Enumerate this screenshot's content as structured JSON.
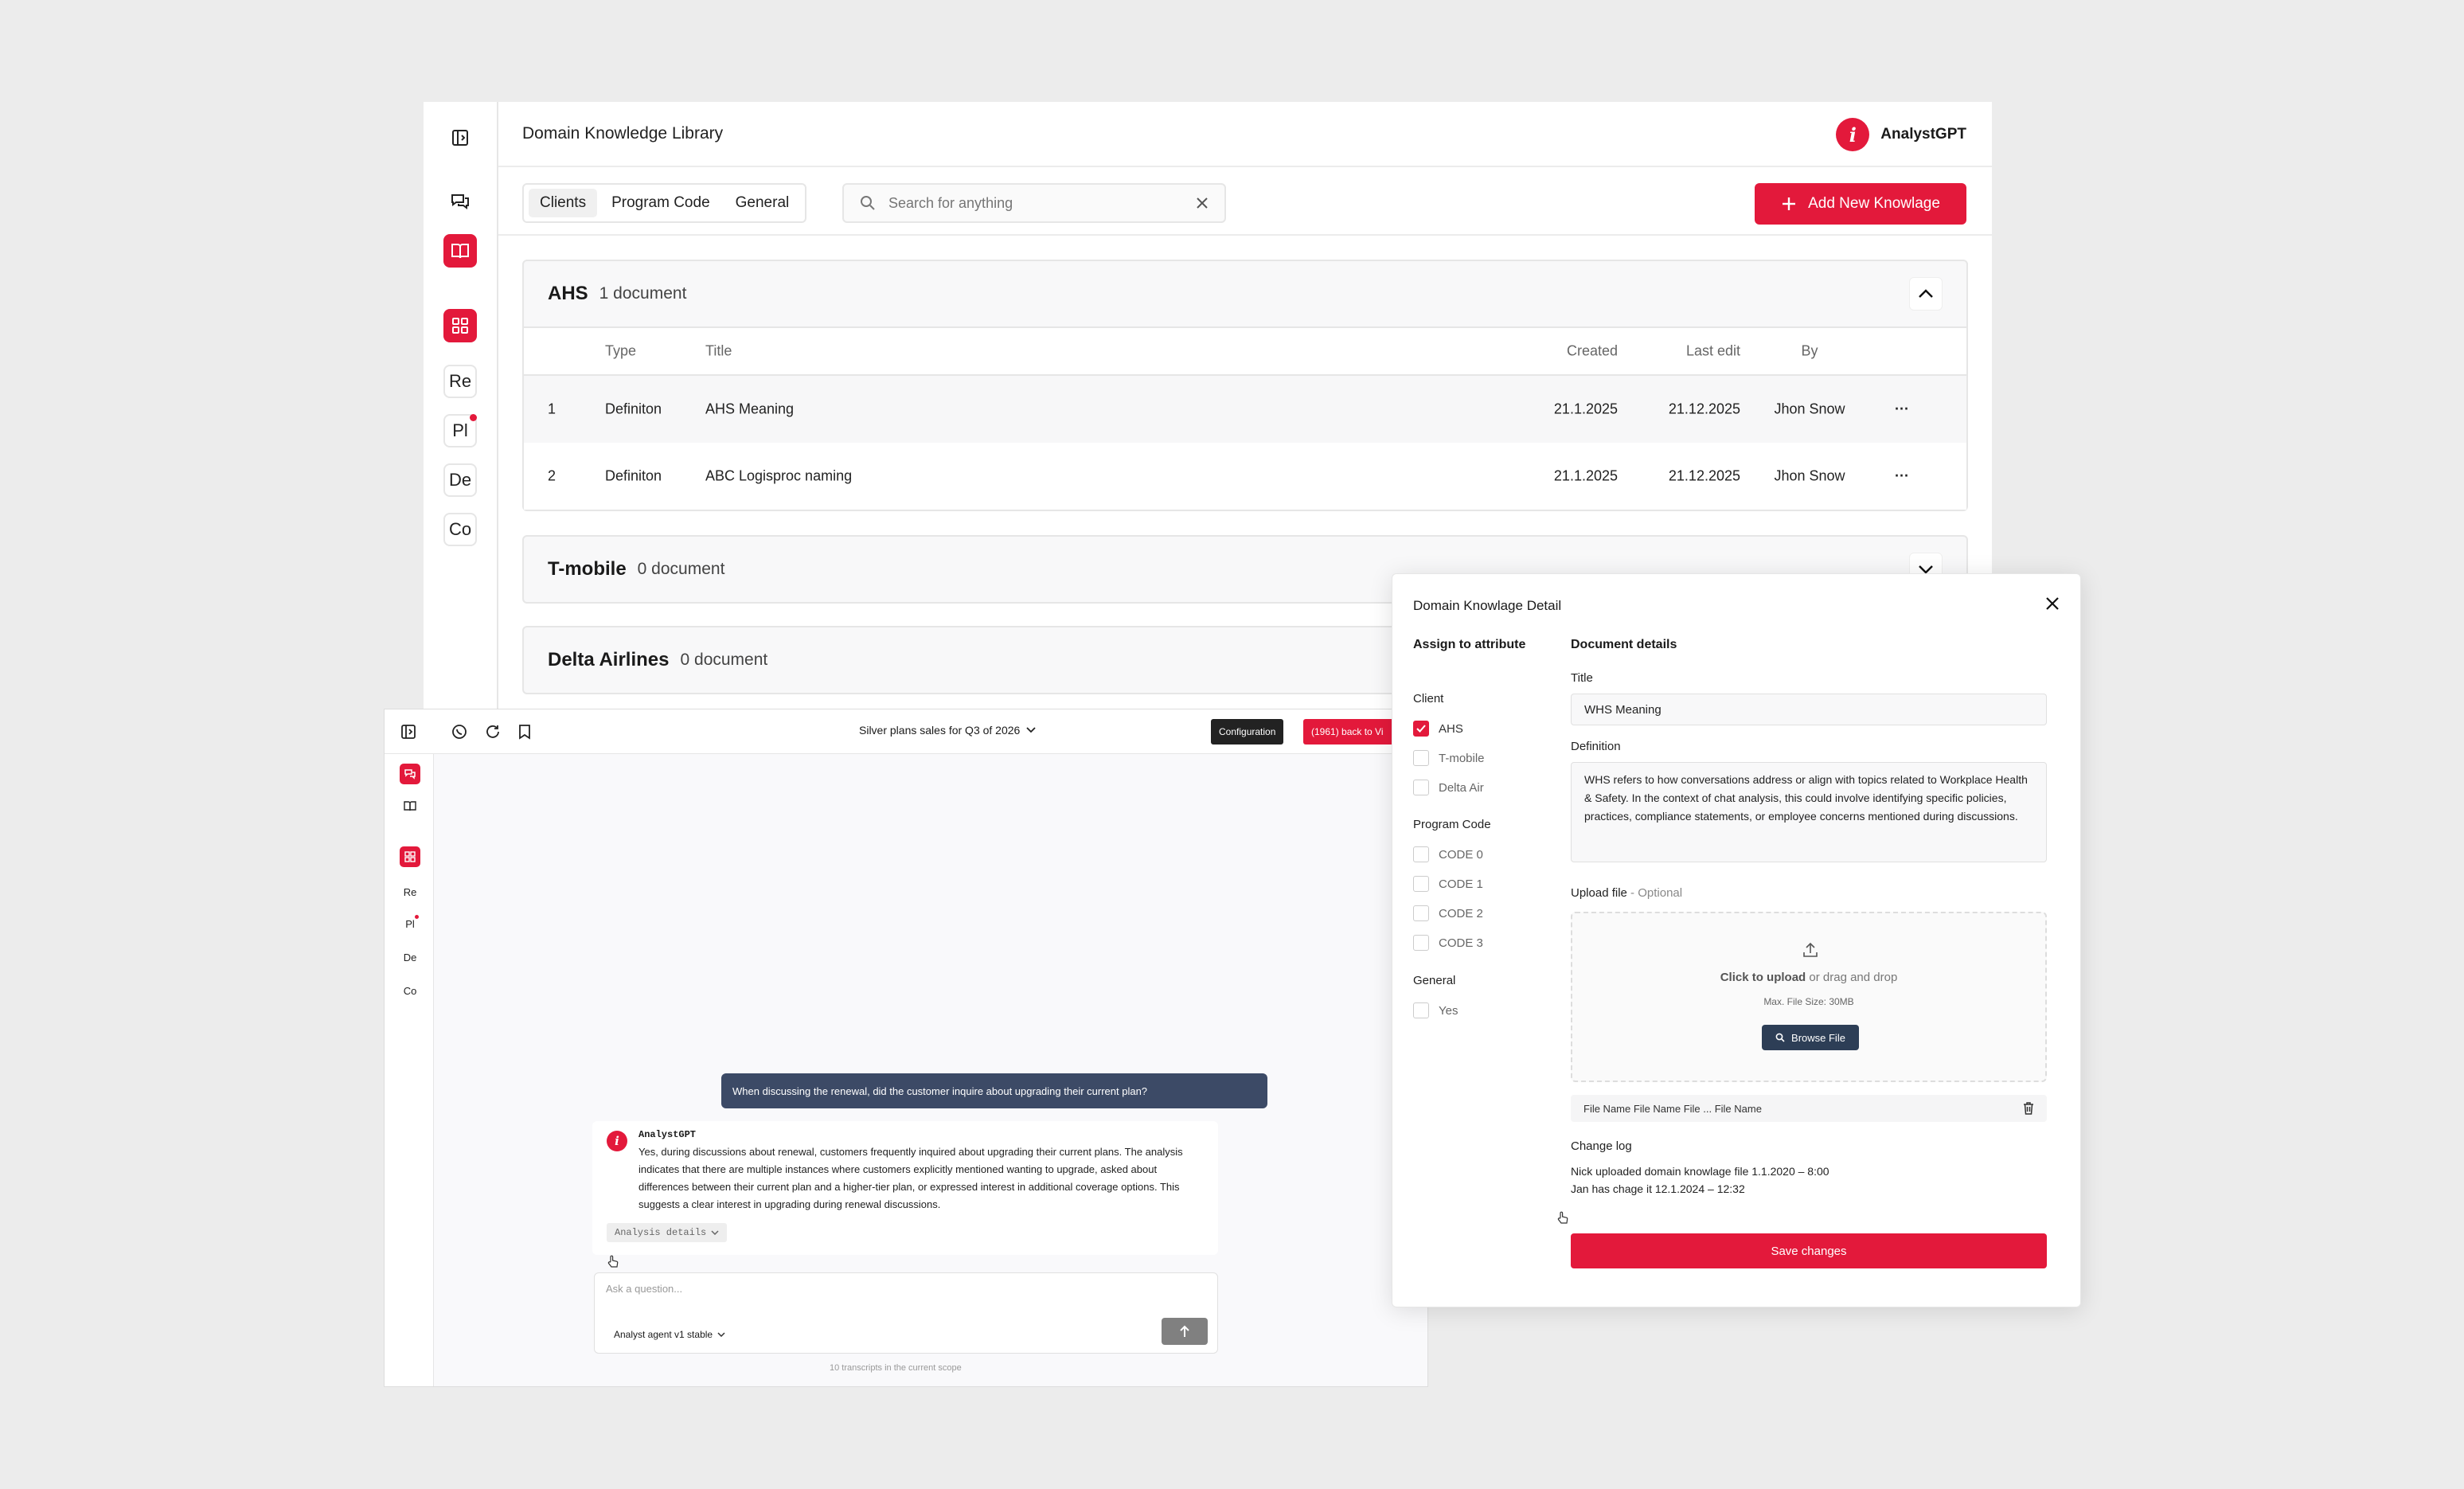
{
  "main": {
    "title": "Domain Knowledge Library",
    "brand": {
      "logo_letter": "i",
      "name": "AnalystGPT",
      "color": "#e3193b"
    },
    "rail_shortcuts": [
      "Re",
      "Pl",
      "De",
      "Co"
    ],
    "tabs": [
      {
        "label": "Clients",
        "active": true
      },
      {
        "label": "Program Code",
        "active": false
      },
      {
        "label": "General",
        "active": false
      }
    ],
    "search": {
      "placeholder": "Search for anything"
    },
    "add_button": "Add New Knowlage",
    "columns": {
      "type": "Type",
      "title": "Title",
      "created": "Created",
      "last_edit": "Last edit",
      "by": "By"
    },
    "groups": [
      {
        "name": "AHS",
        "count": "1 document",
        "expanded": true,
        "rows": [
          {
            "num": "1",
            "type": "Definiton",
            "title": "AHS Meaning",
            "created": "21.1.2025",
            "last_edit": "21.12.2025",
            "by": "Jhon Snow",
            "more": "···"
          },
          {
            "num": "2",
            "type": "Definiton",
            "title": "ABC Logisproc naming",
            "created": "21.1.2025",
            "last_edit": "21.12.2025",
            "by": "Jhon Snow",
            "more": "···"
          }
        ]
      },
      {
        "name": "T-mobile",
        "count": "0 document",
        "expanded": false
      },
      {
        "name": "Delta Airlines",
        "count": "0 document",
        "expanded": false
      }
    ]
  },
  "chat": {
    "rail_shortcuts": [
      "Re",
      "Pl",
      "De",
      "Co"
    ],
    "scope_title": "Silver plans sales for Q3 of 2026",
    "configuration_button": "Configuration",
    "back_button": "(1961) back to Vi",
    "user_message": "When discussing the renewal, did the customer inquire about upgrading their current plan?",
    "bot_name": "AnalystGPT",
    "bot_message": "Yes, during discussions about renewal, customers frequently inquired about upgrading their current plans. The analysis indicates that there are multiple instances where customers explicitly mentioned wanting to upgrade, asked about differences between their current plan and a higher-tier plan, or expressed interest in additional coverage options. This suggests a clear interest in upgrading during renewal discussions.",
    "analysis_details": "Analysis details",
    "composer_placeholder": "Ask a question...",
    "agent": "Analyst agent v1 stable",
    "scope_note": "10 transcripts in the current scope"
  },
  "detail": {
    "title": "Domain Knowlage Detail",
    "assign_heading": "Assign to attribute",
    "client_label": "Client",
    "clients": [
      {
        "label": "AHS",
        "checked": true
      },
      {
        "label": "T-mobile",
        "checked": false
      },
      {
        "label": "Delta Air",
        "checked": false
      }
    ],
    "program_code_label": "Program Code",
    "program_codes": [
      {
        "label": "CODE 0",
        "checked": false
      },
      {
        "label": "CODE 1",
        "checked": false
      },
      {
        "label": "CODE 2",
        "checked": false
      },
      {
        "label": "CODE 3",
        "checked": false
      }
    ],
    "general_label": "General",
    "general_options": [
      {
        "label": "Yes",
        "checked": false
      }
    ],
    "doc_heading": "Document details",
    "title_label": "Title",
    "title_value": "WHS Meaning",
    "definition_label": "Definition",
    "definition_value": "WHS refers to how conversations address or align with topics related to Workplace Health & Safety. In the context of chat analysis, this could involve identifying specific policies, practices, compliance statements, or employee concerns mentioned during discussions.",
    "upload_label": "Upload file",
    "upload_optional": " - Optional",
    "upload_click": "Click to upload",
    "upload_rest": " or drag and drop",
    "upload_max": "Max. File Size: 30MB",
    "browse_button": "Browse File",
    "file_name": "File Name File Name File ... File Name",
    "changelog_label": "Change log",
    "changelog": [
      "Nick uploaded domain knowlage file 1.1.2020 – 8:00",
      "Jan has chage it 12.1.2024 – 12:32"
    ],
    "save_button": "Save changes"
  }
}
